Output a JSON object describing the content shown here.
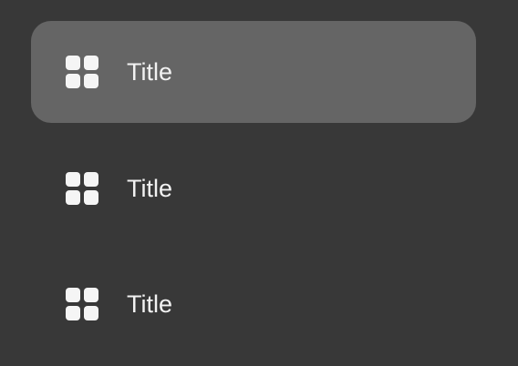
{
  "menu": {
    "items": [
      {
        "label": "Title",
        "icon": "grid-icon",
        "active": true
      },
      {
        "label": "Title",
        "icon": "grid-icon",
        "active": false
      },
      {
        "label": "Title",
        "icon": "grid-icon",
        "active": false
      }
    ]
  },
  "colors": {
    "background": "#383838",
    "active_background": "#656565",
    "text": "#f2f2f2",
    "icon": "#f5f5f5"
  }
}
